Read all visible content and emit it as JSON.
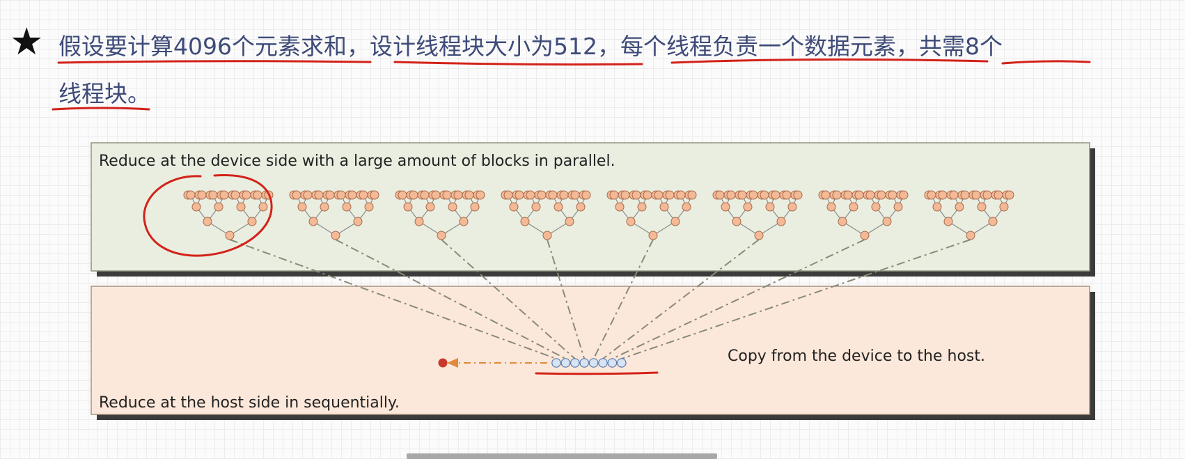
{
  "heading": {
    "line1": "假设要计算4096个元素求和，设计线程块大小为512，每个线程负责一个数据元素，共需8个",
    "line2": "线程块。"
  },
  "diagram": {
    "device_caption": "Reduce at the device side with a large amount of blocks in parallel.",
    "host_caption": "Reduce at the host side in sequentially.",
    "copy_caption": "Copy from the device to the host.",
    "block_count": 8,
    "host_element_count": 8
  },
  "colors": {
    "device_panel": "#e9eee0",
    "host_panel": "#fce8da",
    "tree_node": "#f4b996",
    "host_node": "#d7e4f4",
    "annotation_red": "#d32219",
    "result_dot": "#c9392b",
    "arrow": "#e08a3c"
  }
}
